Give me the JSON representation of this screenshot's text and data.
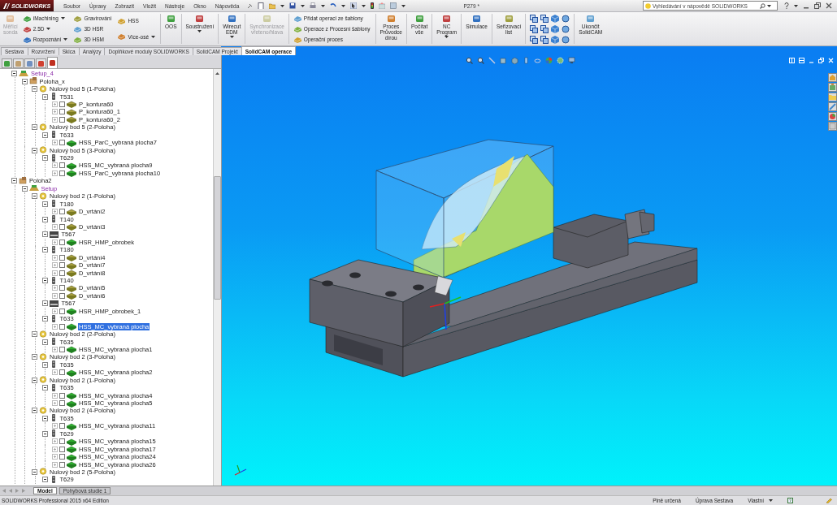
{
  "app": {
    "logo": "SOLIDWORKS",
    "menu": [
      "Soubor",
      "Úpravy",
      "Zobrazit",
      "Vložit",
      "Nástroje",
      "Okno",
      "Nápověda"
    ],
    "title": "P279 *",
    "search": {
      "placeholder": "Vyhledávání v nápovědě SOLIDWORKS"
    }
  },
  "ribbon": {
    "groups": [
      {
        "kind": "large",
        "label": "Měřicí\nsonda",
        "disabled": true,
        "dropdown": false
      },
      {
        "kind": "stack",
        "items": [
          {
            "label": "iMachining",
            "dropdown": true
          },
          {
            "label": "2.5D",
            "dropdown": true
          },
          {
            "label": "Rozpoznání",
            "dropdown": true
          }
        ]
      },
      {
        "kind": "stack",
        "items": [
          {
            "label": "Gravírování",
            "dropdown": false
          },
          {
            "label": "3D HSR",
            "dropdown": false
          },
          {
            "label": "3D HSM",
            "dropdown": false
          }
        ]
      },
      {
        "kind": "stack",
        "items": [
          {
            "label": "HSS",
            "dropdown": false
          },
          {
            "label": "Více-osé",
            "dropdown": true
          }
        ]
      },
      {
        "kind": "large",
        "label": "OOS",
        "disabled": false,
        "dropdown": false
      },
      {
        "kind": "large",
        "label": "Soustružení",
        "disabled": false,
        "dropdown": true
      },
      {
        "kind": "large",
        "label": "Wirecut\nEDM",
        "disabled": false,
        "dropdown": true
      },
      {
        "kind": "large",
        "label": "Synchronizace\nvřeteno/hlava",
        "disabled": true,
        "dropdown": false
      },
      {
        "kind": "stack",
        "items": [
          {
            "label": "Přidat operaci ze šablony",
            "dropdown": false
          },
          {
            "label": "Operace z Procesní šablony",
            "dropdown": false
          },
          {
            "label": "Operační proces",
            "dropdown": false
          }
        ]
      },
      {
        "kind": "large",
        "label": "Proces\nPrůvodce\ndírou",
        "disabled": false,
        "dropdown": false
      },
      {
        "kind": "large",
        "label": "Počítat\nvše",
        "disabled": false,
        "dropdown": false
      },
      {
        "kind": "large",
        "label": "NC\nProgram",
        "disabled": false,
        "dropdown": true
      },
      {
        "kind": "large",
        "label": "Simulace",
        "disabled": false,
        "dropdown": false
      },
      {
        "kind": "large",
        "label": "Seřizovací\nlist",
        "disabled": false,
        "dropdown": false
      },
      {
        "kind": "grid"
      },
      {
        "kind": "large",
        "label": "Ukončit\nSolidCAM",
        "disabled": false,
        "dropdown": false
      }
    ]
  },
  "tabs": [
    {
      "label": "Sestava",
      "selected": false
    },
    {
      "label": "Rozvržení",
      "selected": false
    },
    {
      "label": "Skica",
      "selected": false
    },
    {
      "label": "Analýzy",
      "selected": false
    },
    {
      "label": "Doplňkové moduly SOLIDWORKS",
      "selected": false
    },
    {
      "label": "SolidCAM Projekt",
      "selected": false
    },
    {
      "label": "SolidCAM operace",
      "selected": true
    }
  ],
  "panel_tabs": [
    {
      "selected": false
    },
    {
      "selected": false
    },
    {
      "selected": false
    },
    {
      "selected": false
    },
    {
      "selected": true
    }
  ],
  "tree": [
    {
      "kind": "setup",
      "label": "Setup_4",
      "expanded": true,
      "children": [
        {
          "kind": "position",
          "label": "Poloha_x",
          "expanded": true,
          "children": [
            {
              "kind": "zero",
              "label": "Nulový bod 5 (1-Poloha)",
              "expanded": true,
              "children": [
                {
                  "kind": "tool",
                  "label": "T531",
                  "expanded": true,
                  "children": [
                    {
                      "kind": "op-drill",
                      "label": "P_kontura60",
                      "expanded": false,
                      "checked": false,
                      "selected": false
                    },
                    {
                      "kind": "op-drill",
                      "label": "P_kontura60_1",
                      "expanded": false,
                      "checked": false,
                      "selected": false
                    },
                    {
                      "kind": "op-drill",
                      "label": "P_kontura60_2",
                      "expanded": false,
                      "checked": false,
                      "selected": false
                    }
                  ]
                }
              ]
            },
            {
              "kind": "zero",
              "label": "Nulový bod 5 (2-Poloha)",
              "expanded": true,
              "children": [
                {
                  "kind": "tool",
                  "label": "T633",
                  "expanded": true,
                  "children": [
                    {
                      "kind": "op-mill",
                      "label": "HSS_ParC_vybraná plocha7",
                      "expanded": false,
                      "checked": false,
                      "selected": false
                    }
                  ]
                }
              ]
            },
            {
              "kind": "zero",
              "label": "Nulový bod 5 (3-Poloha)",
              "expanded": true,
              "children": [
                {
                  "kind": "tool",
                  "label": "T629",
                  "expanded": true,
                  "children": [
                    {
                      "kind": "op-mill",
                      "label": "HSS_MC_vybraná plocha9",
                      "expanded": false,
                      "checked": false,
                      "selected": false
                    },
                    {
                      "kind": "op-mill",
                      "label": "HSS_ParC_vybraná plocha10",
                      "expanded": false,
                      "checked": false,
                      "selected": false
                    }
                  ]
                }
              ]
            }
          ]
        }
      ]
    },
    {
      "kind": "position",
      "label": "Poloha2",
      "expanded": true,
      "children": [
        {
          "kind": "setup",
          "label": "Setup",
          "expanded": true,
          "children": [
            {
              "kind": "zero",
              "label": "Nulový bod 2 (1-Poloha)",
              "expanded": true,
              "children": [
                {
                  "kind": "tool",
                  "label": "T180",
                  "expanded": true,
                  "children": [
                    {
                      "kind": "op-drill",
                      "label": "D_vrtání2",
                      "expanded": false,
                      "checked": false,
                      "selected": false
                    }
                  ]
                },
                {
                  "kind": "tool",
                  "label": "T140",
                  "expanded": true,
                  "children": [
                    {
                      "kind": "op-drill",
                      "label": "D_vrtání3",
                      "expanded": false,
                      "checked": false,
                      "selected": false
                    }
                  ]
                },
                {
                  "kind": "tool-wide",
                  "label": "T567",
                  "expanded": true,
                  "children": [
                    {
                      "kind": "op-mill",
                      "label": "HSR_HMP_obrobek",
                      "expanded": false,
                      "checked": false,
                      "selected": false
                    }
                  ]
                },
                {
                  "kind": "tool",
                  "label": "T180",
                  "expanded": true,
                  "children": [
                    {
                      "kind": "op-drill",
                      "label": "D_vrtání4",
                      "expanded": false,
                      "checked": false,
                      "selected": false
                    },
                    {
                      "kind": "op-drill",
                      "label": "D_vrtání7",
                      "expanded": false,
                      "checked": false,
                      "selected": false
                    },
                    {
                      "kind": "op-drill",
                      "label": "D_vrtání8",
                      "expanded": false,
                      "checked": false,
                      "selected": false
                    }
                  ]
                },
                {
                  "kind": "tool",
                  "label": "T140",
                  "expanded": true,
                  "children": [
                    {
                      "kind": "op-drill",
                      "label": "D_vrtání5",
                      "expanded": false,
                      "checked": false,
                      "selected": false
                    },
                    {
                      "kind": "op-drill",
                      "label": "D_vrtání6",
                      "expanded": false,
                      "checked": false,
                      "selected": false
                    }
                  ]
                },
                {
                  "kind": "tool-wide",
                  "label": "T567",
                  "expanded": true,
                  "children": [
                    {
                      "kind": "op-mill",
                      "label": "HSR_HMP_obrobek_1",
                      "expanded": false,
                      "checked": false,
                      "selected": false
                    }
                  ]
                },
                {
                  "kind": "tool",
                  "label": "T633",
                  "expanded": true,
                  "children": [
                    {
                      "kind": "op-mill",
                      "label": "HSS_MC_vybraná plocha",
                      "expanded": false,
                      "checked": false,
                      "selected": true
                    }
                  ]
                }
              ]
            },
            {
              "kind": "zero",
              "label": "Nulový bod 2 (2-Poloha)",
              "expanded": true,
              "children": [
                {
                  "kind": "tool",
                  "label": "T635",
                  "expanded": true,
                  "children": [
                    {
                      "kind": "op-mill",
                      "label": "HSS_MC_vybraná plocha1",
                      "expanded": false,
                      "checked": false,
                      "selected": false
                    }
                  ]
                }
              ]
            },
            {
              "kind": "zero",
              "label": "Nulový bod 2 (3-Poloha)",
              "expanded": true,
              "children": [
                {
                  "kind": "tool",
                  "label": "T635",
                  "expanded": true,
                  "children": [
                    {
                      "kind": "op-mill",
                      "label": "HSS_MC_vybraná plocha2",
                      "expanded": false,
                      "checked": false,
                      "selected": false
                    }
                  ]
                }
              ]
            },
            {
              "kind": "zero",
              "label": "Nulový bod 2 (1-Poloha)",
              "expanded": true,
              "children": [
                {
                  "kind": "tool",
                  "label": "T635",
                  "expanded": true,
                  "children": [
                    {
                      "kind": "op-mill",
                      "label": "HSS_MC_vybraná plocha4",
                      "expanded": false,
                      "checked": false,
                      "selected": false
                    },
                    {
                      "kind": "op-mill",
                      "label": "HSS_MC_vybraná plocha5",
                      "expanded": false,
                      "checked": false,
                      "selected": false
                    }
                  ]
                }
              ]
            },
            {
              "kind": "zero",
              "label": "Nulový bod 2 (4-Poloha)",
              "expanded": true,
              "children": [
                {
                  "kind": "tool",
                  "label": "T635",
                  "expanded": true,
                  "children": [
                    {
                      "kind": "op-mill",
                      "label": "HSS_MC_vybraná plocha11",
                      "expanded": false,
                      "checked": false,
                      "selected": false
                    }
                  ]
                },
                {
                  "kind": "tool",
                  "label": "T629",
                  "expanded": true,
                  "children": [
                    {
                      "kind": "op-mill",
                      "label": "HSS_MC_vybraná plocha15",
                      "expanded": false,
                      "checked": false,
                      "selected": false
                    },
                    {
                      "kind": "op-mill",
                      "label": "HSS_MC_vybraná plocha17",
                      "expanded": false,
                      "checked": false,
                      "selected": false
                    },
                    {
                      "kind": "op-mill",
                      "label": "HSS_MC_vybraná plocha24",
                      "expanded": false,
                      "checked": false,
                      "selected": false
                    },
                    {
                      "kind": "op-mill",
                      "label": "HSS_MC_vybraná plocha26",
                      "expanded": false,
                      "checked": false,
                      "selected": false
                    }
                  ]
                }
              ]
            },
            {
              "kind": "zero",
              "label": "Nulový bod 2 (5-Poloha)",
              "expanded": true,
              "children": [
                {
                  "kind": "tool",
                  "label": "T629",
                  "expanded": true
                }
              ]
            }
          ]
        }
      ]
    }
  ],
  "bottom_tabs": [
    {
      "label": "Model",
      "selected": true
    },
    {
      "label": "Pohybová studie 1",
      "selected": false
    }
  ],
  "status_bar": {
    "edition": "SOLIDWORKS Professional 2015 x64 Edition",
    "items": [
      {
        "label": "Plně určená",
        "dropdown": false
      },
      {
        "label": "Úprava Sestava",
        "dropdown": false
      },
      {
        "label": "Vlastní",
        "dropdown": true
      }
    ]
  }
}
